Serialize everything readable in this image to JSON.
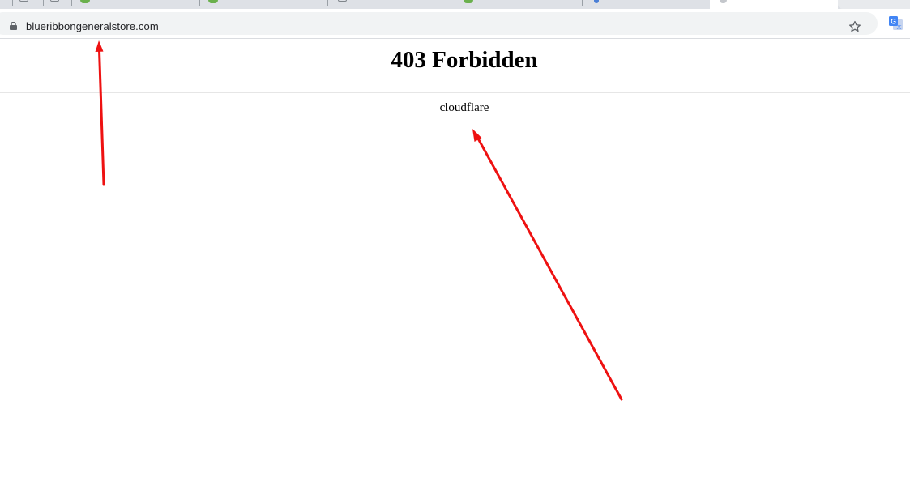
{
  "browser": {
    "url": "blueribbongeneralstore.com",
    "icons": {
      "lock": "lock-icon",
      "star": "star-icon",
      "translate": "google-translate-icon"
    }
  },
  "page": {
    "title": "403 Forbidden",
    "server": "cloudflare"
  },
  "colors": {
    "annotation_arrow": "#ee1111",
    "tab_strip": "#dee1e6",
    "omnibox": "#f1f3f4"
  }
}
